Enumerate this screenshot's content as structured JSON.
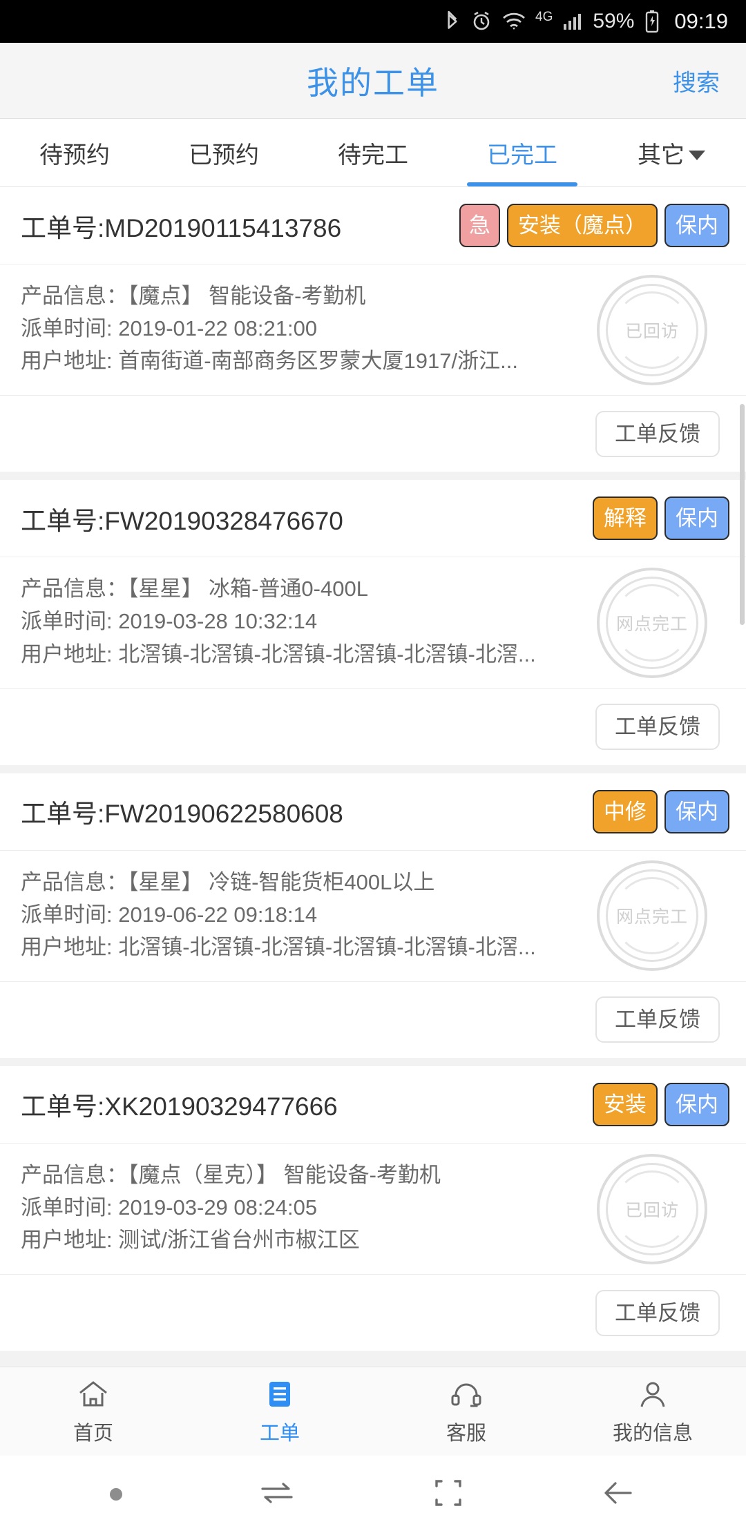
{
  "status_bar": {
    "icons": [
      "bluetooth-icon",
      "alarm-icon",
      "wifi-icon",
      "signal-icon",
      "battery-icon"
    ],
    "network": "4G",
    "battery_percent": "59%",
    "time": "09:19"
  },
  "header": {
    "title": "我的工单",
    "search_label": "搜索"
  },
  "tabs": [
    {
      "label": "待预约",
      "active": false
    },
    {
      "label": "已预约",
      "active": false
    },
    {
      "label": "待完工",
      "active": false
    },
    {
      "label": "已完工",
      "active": true
    },
    {
      "label": "其它",
      "active": false,
      "has_caret": true
    }
  ],
  "labels": {
    "order_prefix": "工单号:",
    "product": "产品信息:",
    "dispatch_time": "派单时间:",
    "user_address": "用户地址:",
    "feedback_button": "工单反馈"
  },
  "colors": {
    "accent": "#3d92e8",
    "badge_urgent": "#f0a0a0",
    "badge_type": "#f0a22a",
    "badge_warranty": "#78a9f5",
    "stamp": "#cfcfcf",
    "text_primary": "#333333",
    "text_secondary": "#6a6a6a"
  },
  "orders": [
    {
      "order_no": "工单号:MD20190115413786",
      "badges": [
        {
          "text": "急",
          "kind": "urgent"
        },
        {
          "text": "安装（魔点）",
          "kind": "type"
        },
        {
          "text": "保内",
          "kind": "warranty"
        }
      ],
      "product": "产品信息：【魔点】 智能设备-考勤机",
      "dispatch_time": "派单时间: 2019-01-22 08:21:00",
      "address": "用户地址: 首南街道-南部商务区罗蒙大厦1917/浙江...",
      "stamp": "已回访",
      "feedback": "工单反馈"
    },
    {
      "order_no": "工单号:FW20190328476670",
      "badges": [
        {
          "text": "解释",
          "kind": "type"
        },
        {
          "text": "保内",
          "kind": "warranty"
        }
      ],
      "product": "产品信息：【星星】 冰箱-普通0-400L",
      "dispatch_time": "派单时间: 2019-03-28 10:32:14",
      "address": "用户地址: 北滘镇-北滘镇-北滘镇-北滘镇-北滘镇-北滘...",
      "stamp": "网点完工",
      "feedback": "工单反馈"
    },
    {
      "order_no": "工单号:FW20190622580608",
      "badges": [
        {
          "text": "中修",
          "kind": "type"
        },
        {
          "text": "保内",
          "kind": "warranty"
        }
      ],
      "product": "产品信息：【星星】 冷链-智能货柜400L以上",
      "dispatch_time": "派单时间: 2019-06-22 09:18:14",
      "address": "用户地址: 北滘镇-北滘镇-北滘镇-北滘镇-北滘镇-北滘...",
      "stamp": "网点完工",
      "feedback": "工单反馈"
    },
    {
      "order_no": "工单号:XK20190329477666",
      "badges": [
        {
          "text": "安装",
          "kind": "type"
        },
        {
          "text": "保内",
          "kind": "warranty"
        }
      ],
      "product": "产品信息：【魔点（星克）】 智能设备-考勤机",
      "dispatch_time": "派单时间: 2019-03-29 08:24:05",
      "address": "用户地址: 测试/浙江省台州市椒江区",
      "stamp": "已回访",
      "feedback": "工单反馈"
    }
  ],
  "bottom_nav": [
    {
      "label": "首页",
      "icon": "home-icon",
      "active": false
    },
    {
      "label": "工单",
      "icon": "list-icon",
      "active": true
    },
    {
      "label": "客服",
      "icon": "headset-icon",
      "active": false
    },
    {
      "label": "我的信息",
      "icon": "person-icon",
      "active": false
    }
  ],
  "android_nav": [
    "dot-icon",
    "recents-icon",
    "home-square-icon",
    "back-arrow-icon"
  ]
}
